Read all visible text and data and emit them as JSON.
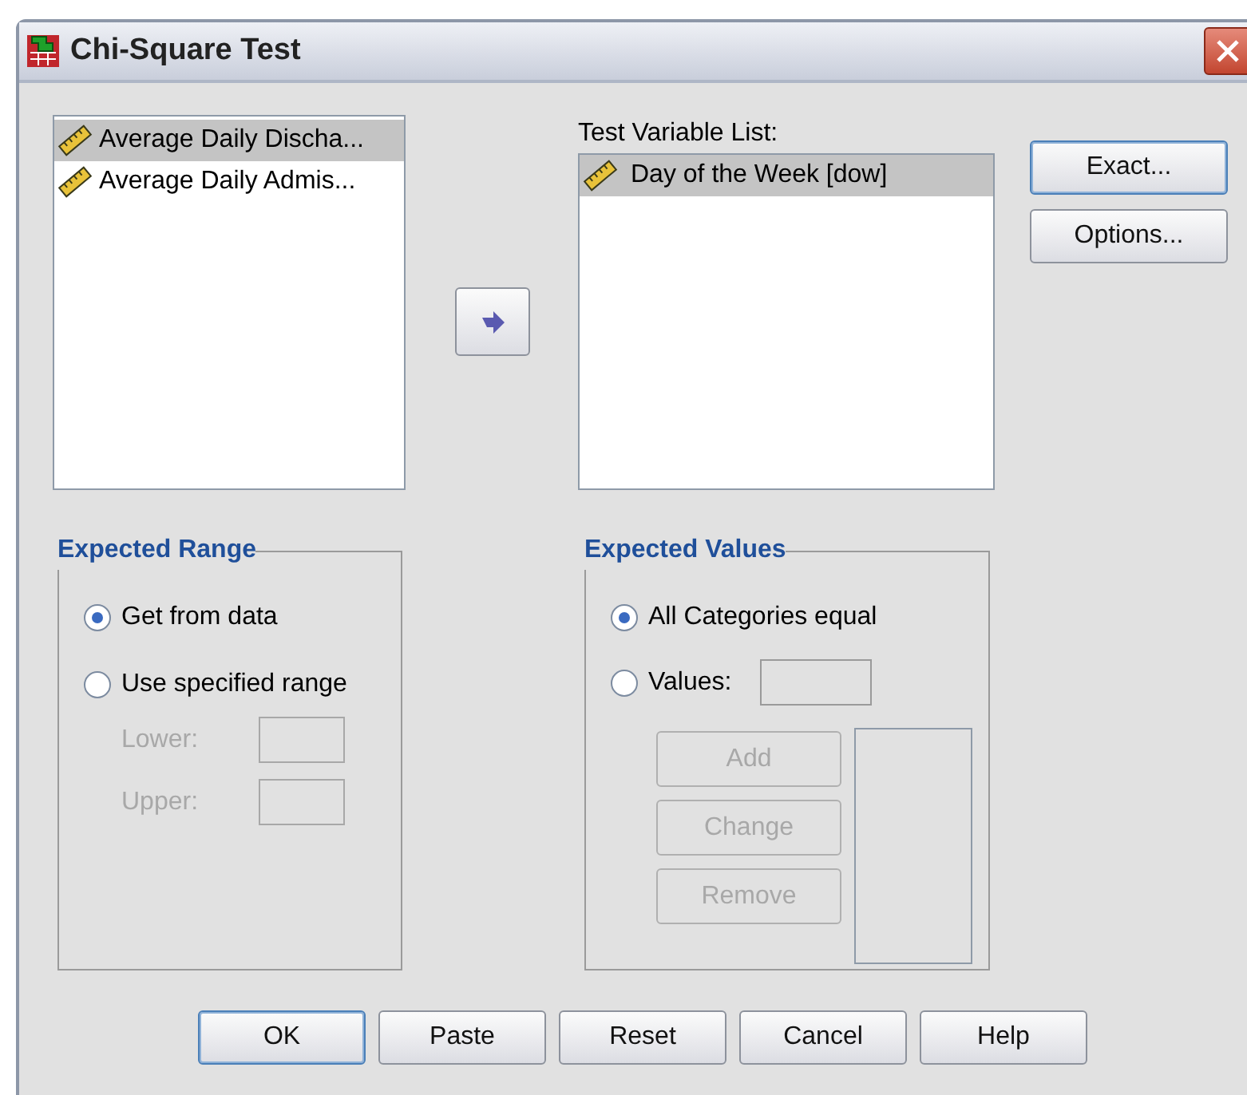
{
  "window": {
    "title": "Chi-Square Test"
  },
  "source_list": {
    "items": [
      {
        "label": "Average Daily Discha...",
        "selected": true
      },
      {
        "label": "Average Daily Admis...",
        "selected": false
      }
    ]
  },
  "target_list": {
    "label": "Test Variable List:",
    "items": [
      {
        "label": "Day of the Week [dow]",
        "selected": true
      }
    ]
  },
  "side_buttons": [
    {
      "label": "Exact...",
      "default": true
    },
    {
      "label": "Options...",
      "default": false
    }
  ],
  "expected_range": {
    "title": "Expected Range",
    "options": [
      {
        "label": "Get from data",
        "selected": true
      },
      {
        "label": "Use specified range",
        "selected": false
      }
    ],
    "fields": [
      {
        "label": "Lower:",
        "disabled": true
      },
      {
        "label": "Upper:",
        "disabled": true
      }
    ]
  },
  "expected_values": {
    "title": "Expected Values",
    "options": [
      {
        "label": "All Categories equal",
        "selected": true,
        "has_field": false
      },
      {
        "label": "Values:",
        "selected": false,
        "has_field": true
      }
    ],
    "buttons": [
      {
        "label": "Add",
        "disabled": true
      },
      {
        "label": "Change",
        "disabled": true
      },
      {
        "label": "Remove",
        "disabled": true
      }
    ]
  },
  "buttons": [
    {
      "label": "OK",
      "default": true
    },
    {
      "label": "Paste",
      "default": false
    },
    {
      "label": "Reset",
      "default": false
    },
    {
      "label": "Cancel",
      "default": false
    },
    {
      "label": "Help",
      "default": false
    }
  ]
}
